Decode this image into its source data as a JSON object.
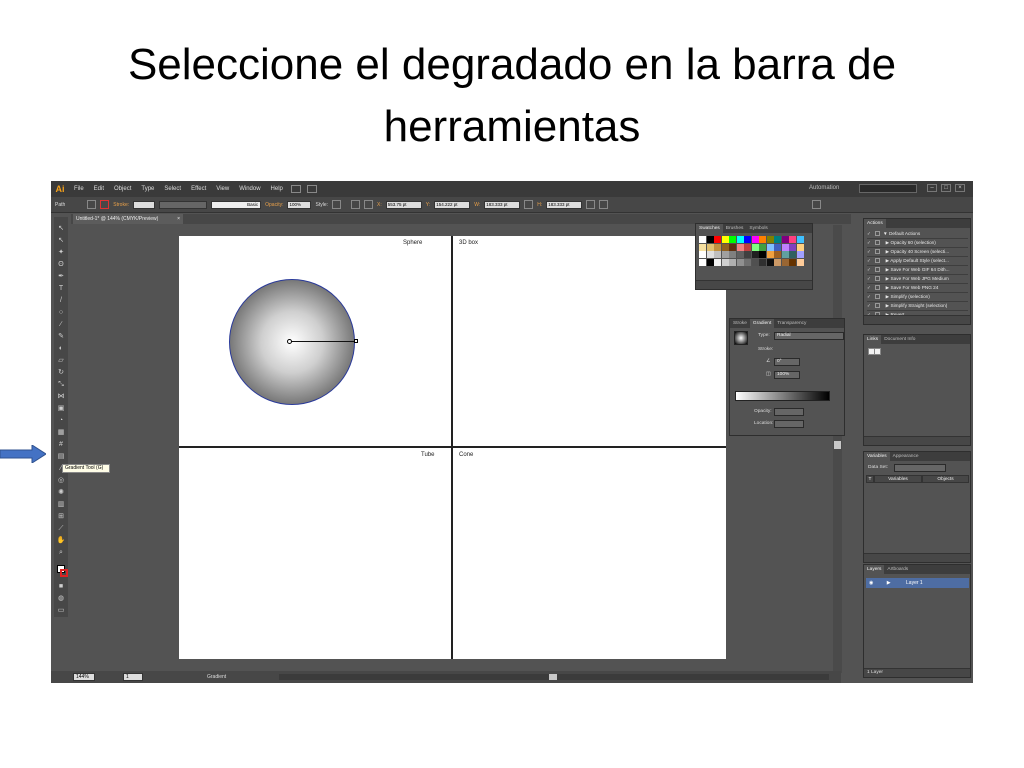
{
  "slide": {
    "title": "Seleccione el degradado en la barra de herramientas"
  },
  "menubar": {
    "logo": "Ai",
    "items": [
      "File",
      "Edit",
      "Object",
      "Type",
      "Select",
      "Effect",
      "View",
      "Window",
      "Help"
    ],
    "workspace": "Automation"
  },
  "controlbar": {
    "object_type": "Path",
    "stroke_label": "Stroke:",
    "brush": "Basic",
    "opacity_label": "Opacity:",
    "opacity_value": "100%",
    "style_label": "Style:",
    "x_label": "X:",
    "x_value": "553.75 pt",
    "y_label": "Y:",
    "y_value": "154.222 pt",
    "w_label": "W:",
    "w_value": "183.333 pt",
    "h_label": "H:",
    "h_value": "183.333 pt"
  },
  "document": {
    "tab_title": "Untitled-1* @ 144% (CMYK/Preview)"
  },
  "tools": {
    "tooltip": "Gradient Tool (G)"
  },
  "artboard": {
    "labels": {
      "sphere": "Sphere",
      "box": "3D box",
      "tube": "Tube",
      "cone": "Cone"
    }
  },
  "status": {
    "zoom": "144%",
    "page": "1",
    "tool_name": "Gradient"
  },
  "swatches_panel": {
    "tabs": [
      "Swatches",
      "Brushes",
      "Symbols"
    ],
    "colors": [
      "#ffffff",
      "#000000",
      "#ff0000",
      "#ffff00",
      "#00ff00",
      "#00ffff",
      "#0000ff",
      "#ff00ff",
      "#ff8000",
      "#808000",
      "#008080",
      "#800080",
      "#ff4080",
      "#40c0ff",
      "#f6e0a0",
      "#e0c070",
      "#c09040",
      "#906020",
      "#603010",
      "#f08080",
      "#c04040",
      "#80ff80",
      "#40a040",
      "#80c0ff",
      "#4060c0",
      "#c080ff",
      "#8040c0",
      "#ffd080",
      "#ffffff",
      "#e0e0e0",
      "#c0c0c0",
      "#a0a0a0",
      "#808080",
      "#606060",
      "#404040",
      "#202020",
      "#000000",
      "#f0a040",
      "#a06020",
      "#60a0a0",
      "#306060",
      "#a0a0ff",
      "#ffffff",
      "#000000",
      "#f0f0f0",
      "#d0d0d0",
      "#b0b0b0",
      "#909090",
      "#707070",
      "#505050",
      "#303030",
      "#101010",
      "#cc9966",
      "#996633",
      "#663300",
      "#ffcc99"
    ]
  },
  "actions_panel": {
    "tabs": [
      "Actions"
    ],
    "rows": [
      "Default Actions",
      "Opacity 60 (selection)",
      "Opacity 40 Screen (selecti...",
      "Apply Default Style (select...",
      "Save For Web GIF 64 Dith...",
      "Save For Web JPG Medium",
      "Save For Web PNG 24",
      "Simplify (selection)",
      "Simplify Straight (selection)",
      "Revert"
    ]
  },
  "gradient_panel": {
    "tabs": [
      "Stroke",
      "Gradient",
      "Transparency"
    ],
    "type_label": "Type:",
    "type_value": "Radial",
    "stroke_label": "Stroke:",
    "angle_value": "0°",
    "aspect_value": "100%",
    "opacity_label": "Opacity:",
    "location_label": "Location:"
  },
  "links_panel": {
    "tabs": [
      "Links",
      "Document Info"
    ]
  },
  "variables_panel": {
    "tabs": [
      "Variables",
      "Appearance"
    ],
    "dataset_label": "Data Set:",
    "columns": [
      "Variables",
      "Objects"
    ]
  },
  "layers_panel": {
    "tabs": [
      "Layers",
      "Artboards"
    ],
    "layer_name": "Layer 1",
    "count": "1 Layer"
  },
  "colors": {
    "accent": "#f7a21b",
    "selection": "#4e6da3",
    "arrow": "#4472c4"
  }
}
